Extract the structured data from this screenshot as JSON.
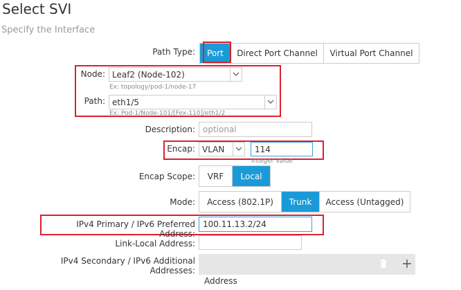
{
  "header": {
    "title": "Select SVI",
    "subtitle": "Specify the Interface"
  },
  "path_type": {
    "label": "Path Type:",
    "options": [
      "Port",
      "Direct Port Channel",
      "Virtual Port Channel"
    ],
    "selected": "Port"
  },
  "node": {
    "label": "Node:",
    "value": "Leaf2 (Node-102)",
    "hint": "Ex: topology/pod-1/node-17"
  },
  "path": {
    "label": "Path:",
    "value": "eth1/5",
    "hint": "Ex: Pod-1/Node-101/[Fex-110]/eth1/2"
  },
  "description": {
    "label": "Description:",
    "placeholder": "optional"
  },
  "encap": {
    "label": "Encap:",
    "type": "VLAN",
    "value": "114",
    "hint": "Integer Value"
  },
  "encap_scope": {
    "label": "Encap Scope:",
    "options": [
      "VRF",
      "Local"
    ],
    "selected": "Local"
  },
  "mode": {
    "label": "Mode:",
    "options": [
      "Access (802.1P)",
      "Trunk",
      "Access (Untagged)"
    ],
    "selected": "Trunk"
  },
  "ipv4": {
    "label": "IPv4 Primary / IPv6 Preferred Address:",
    "value": "100.11.13.2/24"
  },
  "link_local": {
    "label": "Link-Local Address:",
    "value": ""
  },
  "secondary": {
    "label": "IPv4 Secondary / IPv6 Additional Addresses:",
    "column": "Address"
  },
  "colors": {
    "accent": "#1a9bd7",
    "highlight": "#d9202d"
  },
  "icons": [
    "chevron-down-icon",
    "trash-icon",
    "plus-icon"
  ]
}
